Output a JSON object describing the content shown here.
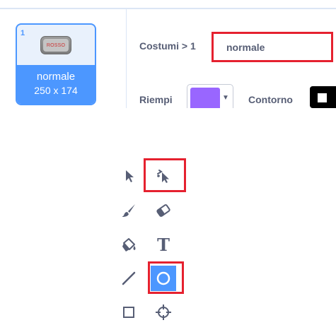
{
  "costume_card": {
    "number": "1",
    "thumbnail_text": "ROSSO",
    "name": "normale",
    "size": "250 x 174"
  },
  "costume_panel": {
    "label": "Costumi > 1",
    "name_value": "normale",
    "fill_label": "Riempi",
    "fill_color": "#9966ff",
    "outline_label": "Contorno",
    "outline_color": "#000000"
  },
  "tools": {
    "icons": [
      "select-icon",
      "reshape-icon",
      "brush-icon",
      "eraser-icon",
      "fill-icon",
      "text-icon",
      "line-icon",
      "circle-icon",
      "rectangle-icon",
      "target-icon"
    ],
    "text_tool_glyph": "T",
    "selected_tool": "circle-icon",
    "highlighted_tools": [
      "reshape-icon",
      "circle-icon"
    ],
    "highlight_color": "#e5212f",
    "accent_color": "#4c97ff"
  }
}
